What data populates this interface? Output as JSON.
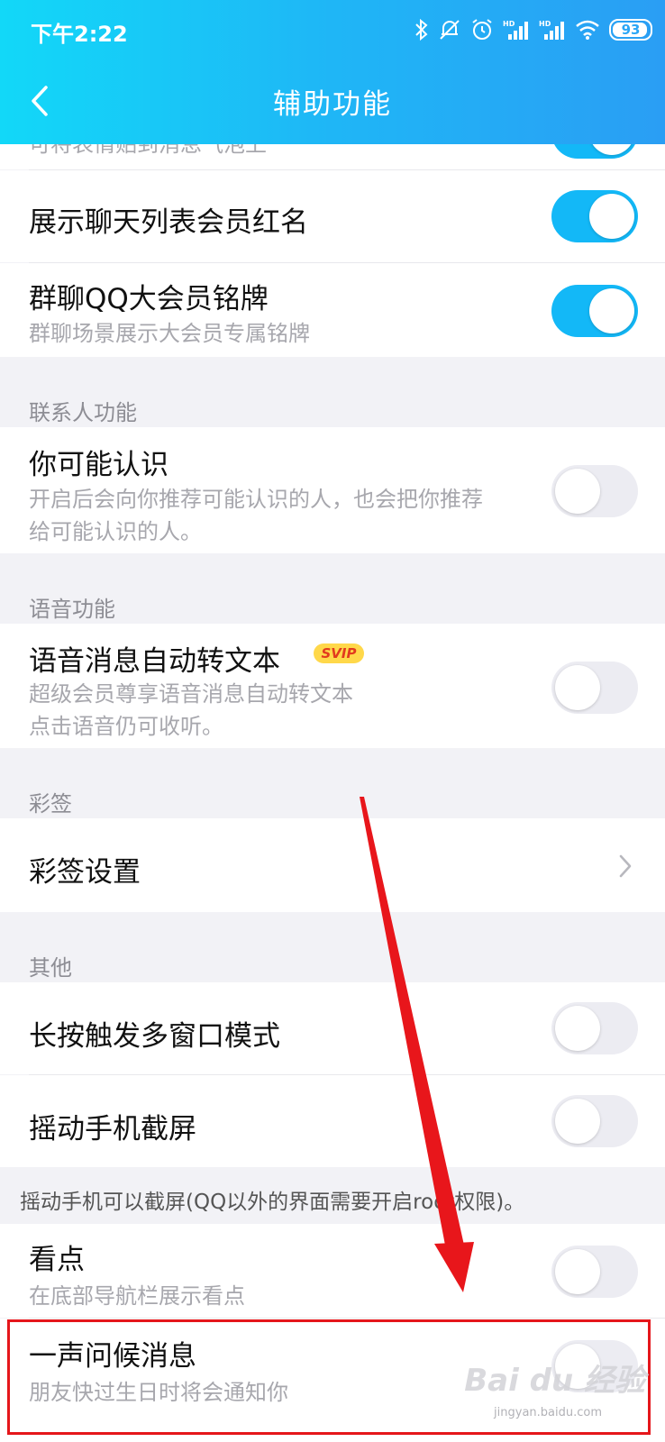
{
  "status_bar": {
    "time": "下午2:22",
    "battery": "93"
  },
  "nav": {
    "title": "辅助功能"
  },
  "rows": {
    "sticker_top_sub": "可将表情贴到消息气泡上",
    "show_vip_name": {
      "title": "展示聊天列表会员红名",
      "on": true
    },
    "group_badge": {
      "title": "群聊QQ大会员铭牌",
      "sub": "群聊场景展示大会员专属铭牌",
      "on": true
    },
    "maybe_know": {
      "title": "你可能认识",
      "sub1": "开启后会向你推荐可能认识的人，也会把你推荐",
      "sub2": "给可能认识的人。",
      "on": false
    },
    "voice_to_text": {
      "title": "语音消息自动转文本",
      "badge": "SVIP",
      "sub1": "超级会员尊享语音消息自动转文本",
      "sub2": "点击语音仍可收听。",
      "on": false
    },
    "caiqian_settings": {
      "title": "彩签设置"
    },
    "long_press_multiwindow": {
      "title": "长按触发多窗口模式",
      "on": false
    },
    "shake_screenshot": {
      "title": "摇动手机截屏",
      "on": false
    },
    "kandian": {
      "title": "看点",
      "sub": "在底部导航栏展示看点",
      "on": false
    },
    "greeting": {
      "title": "一声问候消息",
      "sub": "朋友快过生日时将会通知你",
      "on": false
    }
  },
  "sections": {
    "contacts": "联系人功能",
    "voice": "语音功能",
    "caiqian": "彩签",
    "other": "其他"
  },
  "notes": {
    "shake_note": "摇动手机可以截屏(QQ以外的界面需要开启root权限)。"
  },
  "watermark": {
    "text": "Bai du 经验",
    "sub": "jingyan.baidu.com"
  },
  "colors": {
    "accent": "#13b8f7",
    "annotation": "#e5161b"
  }
}
